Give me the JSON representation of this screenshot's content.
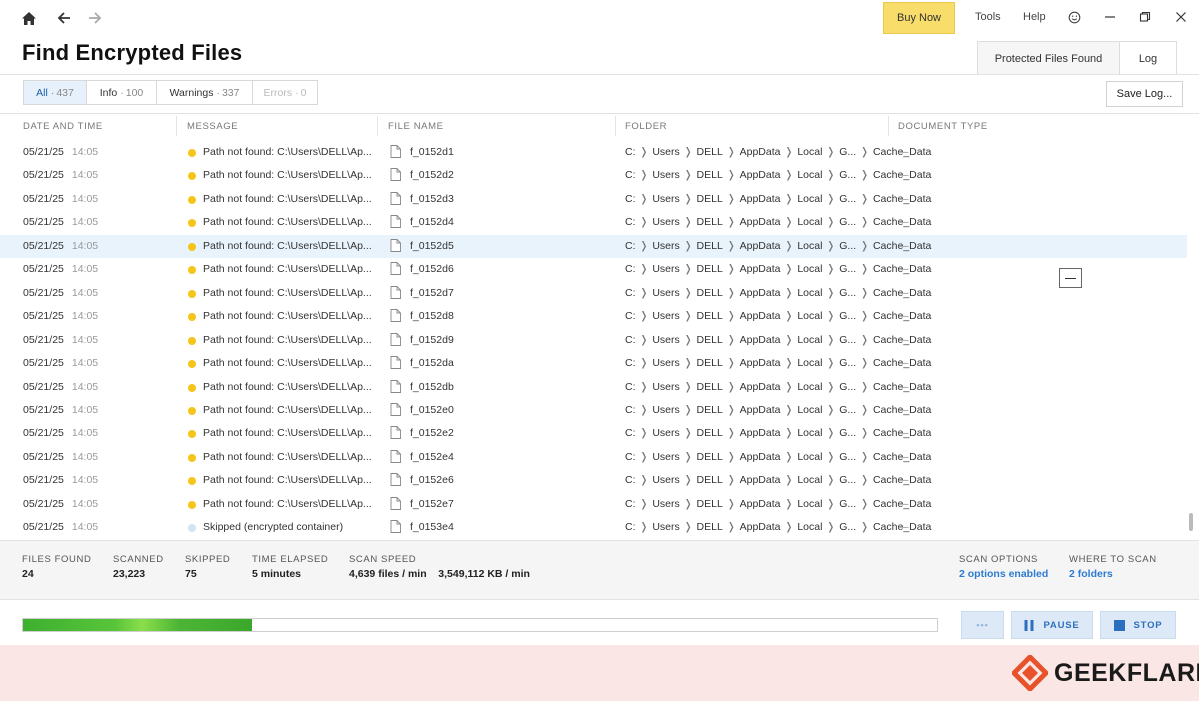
{
  "topbar": {
    "buy_now": "Buy Now",
    "tools": "Tools",
    "help": "Help"
  },
  "page": {
    "title": "Find Encrypted Files",
    "tabs": [
      "Protected Files Found",
      "Log"
    ],
    "active_tab": "Log"
  },
  "filters": {
    "items": [
      {
        "label": "All",
        "count": "437"
      },
      {
        "label": "Info",
        "count": "100"
      },
      {
        "label": "Warnings",
        "count": "337"
      },
      {
        "label": "Errors",
        "count": "0"
      }
    ],
    "save_log": "Save Log..."
  },
  "table": {
    "columns": [
      "DATE AND TIME",
      "MESSAGE",
      "FILE NAME",
      "FOLDER",
      "DOCUMENT TYPE"
    ],
    "rows": [
      {
        "date": "05/21/25",
        "time": "14:05",
        "level": "warning",
        "message": "Path not found: C:\\Users\\DELL\\Ap...",
        "file": "f_0152d1",
        "folder": [
          "C:",
          "Users",
          "DELL",
          "AppData",
          "Local",
          "G...",
          "Cache_Data"
        ],
        "doc_type": "—"
      },
      {
        "date": "05/21/25",
        "time": "14:05",
        "level": "warning",
        "message": "Path not found: C:\\Users\\DELL\\Ap...",
        "file": "f_0152d2",
        "folder": [
          "C:",
          "Users",
          "DELL",
          "AppData",
          "Local",
          "G...",
          "Cache_Data"
        ],
        "doc_type": "—"
      },
      {
        "date": "05/21/25",
        "time": "14:05",
        "level": "warning",
        "message": "Path not found: C:\\Users\\DELL\\Ap...",
        "file": "f_0152d3",
        "folder": [
          "C:",
          "Users",
          "DELL",
          "AppData",
          "Local",
          "G...",
          "Cache_Data"
        ],
        "doc_type": "—"
      },
      {
        "date": "05/21/25",
        "time": "14:05",
        "level": "warning",
        "message": "Path not found: C:\\Users\\DELL\\Ap...",
        "file": "f_0152d4",
        "folder": [
          "C:",
          "Users",
          "DELL",
          "AppData",
          "Local",
          "G...",
          "Cache_Data"
        ],
        "doc_type": "—"
      },
      {
        "date": "05/21/25",
        "time": "14:05",
        "level": "warning",
        "message": "Path not found: C:\\Users\\DELL\\Ap...",
        "file": "f_0152d5",
        "folder": [
          "C:",
          "Users",
          "DELL",
          "AppData",
          "Local",
          "G...",
          "Cache_Data"
        ],
        "doc_type": "—",
        "selected": true
      },
      {
        "date": "05/21/25",
        "time": "14:05",
        "level": "warning",
        "message": "Path not found: C:\\Users\\DELL\\Ap...",
        "file": "f_0152d6",
        "folder": [
          "C:",
          "Users",
          "DELL",
          "AppData",
          "Local",
          "G...",
          "Cache_Data"
        ],
        "doc_type": "—"
      },
      {
        "date": "05/21/25",
        "time": "14:05",
        "level": "warning",
        "message": "Path not found: C:\\Users\\DELL\\Ap...",
        "file": "f_0152d7",
        "folder": [
          "C:",
          "Users",
          "DELL",
          "AppData",
          "Local",
          "G...",
          "Cache_Data"
        ],
        "doc_type": "—"
      },
      {
        "date": "05/21/25",
        "time": "14:05",
        "level": "warning",
        "message": "Path not found: C:\\Users\\DELL\\Ap...",
        "file": "f_0152d8",
        "folder": [
          "C:",
          "Users",
          "DELL",
          "AppData",
          "Local",
          "G...",
          "Cache_Data"
        ],
        "doc_type": "—"
      },
      {
        "date": "05/21/25",
        "time": "14:05",
        "level": "warning",
        "message": "Path not found: C:\\Users\\DELL\\Ap...",
        "file": "f_0152d9",
        "folder": [
          "C:",
          "Users",
          "DELL",
          "AppData",
          "Local",
          "G...",
          "Cache_Data"
        ],
        "doc_type": "—"
      },
      {
        "date": "05/21/25",
        "time": "14:05",
        "level": "warning",
        "message": "Path not found: C:\\Users\\DELL\\Ap...",
        "file": "f_0152da",
        "folder": [
          "C:",
          "Users",
          "DELL",
          "AppData",
          "Local",
          "G...",
          "Cache_Data"
        ],
        "doc_type": "—"
      },
      {
        "date": "05/21/25",
        "time": "14:05",
        "level": "warning",
        "message": "Path not found: C:\\Users\\DELL\\Ap...",
        "file": "f_0152db",
        "folder": [
          "C:",
          "Users",
          "DELL",
          "AppData",
          "Local",
          "G...",
          "Cache_Data"
        ],
        "doc_type": "—"
      },
      {
        "date": "05/21/25",
        "time": "14:05",
        "level": "warning",
        "message": "Path not found: C:\\Users\\DELL\\Ap...",
        "file": "f_0152e0",
        "folder": [
          "C:",
          "Users",
          "DELL",
          "AppData",
          "Local",
          "G...",
          "Cache_Data"
        ],
        "doc_type": "—"
      },
      {
        "date": "05/21/25",
        "time": "14:05",
        "level": "warning",
        "message": "Path not found: C:\\Users\\DELL\\Ap...",
        "file": "f_0152e2",
        "folder": [
          "C:",
          "Users",
          "DELL",
          "AppData",
          "Local",
          "G...",
          "Cache_Data"
        ],
        "doc_type": "—"
      },
      {
        "date": "05/21/25",
        "time": "14:05",
        "level": "warning",
        "message": "Path not found: C:\\Users\\DELL\\Ap...",
        "file": "f_0152e4",
        "folder": [
          "C:",
          "Users",
          "DELL",
          "AppData",
          "Local",
          "G...",
          "Cache_Data"
        ],
        "doc_type": "—"
      },
      {
        "date": "05/21/25",
        "time": "14:05",
        "level": "warning",
        "message": "Path not found: C:\\Users\\DELL\\Ap...",
        "file": "f_0152e6",
        "folder": [
          "C:",
          "Users",
          "DELL",
          "AppData",
          "Local",
          "G...",
          "Cache_Data"
        ],
        "doc_type": "—"
      },
      {
        "date": "05/21/25",
        "time": "14:05",
        "level": "warning",
        "message": "Path not found: C:\\Users\\DELL\\Ap...",
        "file": "f_0152e7",
        "folder": [
          "C:",
          "Users",
          "DELL",
          "AppData",
          "Local",
          "G...",
          "Cache_Data"
        ],
        "doc_type": "—"
      },
      {
        "date": "05/21/25",
        "time": "14:05",
        "level": "info",
        "message": "Skipped (encrypted container)",
        "file": "f_0153e4",
        "folder": [
          "C:",
          "Users",
          "DELL",
          "AppData",
          "Local",
          "G...",
          "Cache_Data"
        ],
        "doc_type": "—"
      }
    ]
  },
  "stats": {
    "files_found": {
      "label": "FILES FOUND",
      "value": "24"
    },
    "scanned": {
      "label": "SCANNED",
      "value": "23,223"
    },
    "skipped": {
      "label": "SKIPPED",
      "value": "75"
    },
    "time_elapsed": {
      "label": "TIME ELAPSED",
      "value": "5 minutes"
    },
    "scan_speed": {
      "label": "SCAN SPEED",
      "value": "4,639 files / min    3,549,112 KB / min"
    },
    "scan_options": {
      "label": "SCAN OPTIONS",
      "value": "2 options enabled"
    },
    "where_to_scan": {
      "label": "WHERE TO SCAN",
      "value": "2 folders"
    }
  },
  "progress": {
    "fraction": 0.25,
    "more": "•••",
    "pause": "PAUSE",
    "stop": "STOP"
  },
  "brand": {
    "name": "GEEKFLARE",
    "accent": "#e8522b"
  },
  "colors": {
    "warning_dot": "#f5c518",
    "info_dot": "#cfe4f5",
    "selected_row": "#e8f3fb",
    "link": "#2d7bd1",
    "buy_now": "#f8dd6b"
  }
}
